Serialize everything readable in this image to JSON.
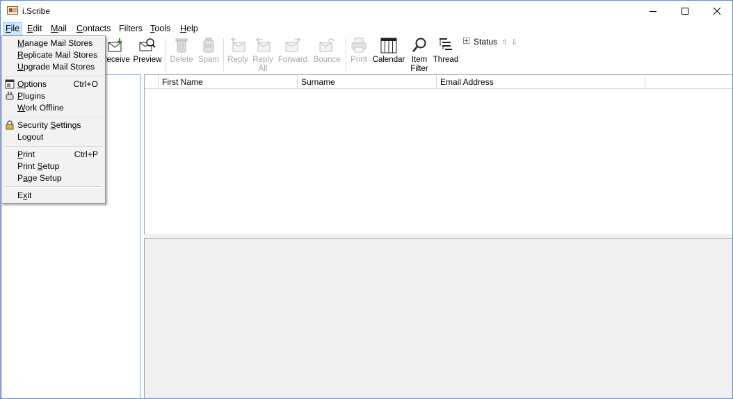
{
  "window": {
    "title": "i.Scribe"
  },
  "menubar": {
    "items": [
      {
        "label": "File",
        "mnemonic": "F",
        "rest": "ile"
      },
      {
        "label": "Edit",
        "mnemonic": "E",
        "rest": "dit"
      },
      {
        "label": "Mail",
        "mnemonic": "M",
        "rest": "ail"
      },
      {
        "label": "Contacts",
        "mnemonic": "C",
        "rest": "ontacts"
      },
      {
        "label": "Filters",
        "mnemonic": "",
        "rest": "Filters"
      },
      {
        "label": "Tools",
        "mnemonic": "T",
        "rest": "ools"
      },
      {
        "label": "Help",
        "mnemonic": "H",
        "rest": "elp"
      }
    ]
  },
  "toolbar": {
    "receive": "Receive",
    "preview": "Preview",
    "delete": "Delete",
    "spam": "Spam",
    "reply": "Reply",
    "reply_all_1": "Reply",
    "reply_all_2": "All",
    "forward": "Forward",
    "bounce": "Bounce",
    "print": "Print",
    "calendar": "Calendar",
    "item_filter_1": "Item",
    "item_filter_2": "Filter",
    "thread": "Thread",
    "status": "Status"
  },
  "columns": [
    "First Name",
    "Surname",
    "Email Address"
  ],
  "file_menu": {
    "manage_pre": "",
    "manage_mn": "M",
    "manage_post": "anage Mail Stores",
    "replicate_pre": "",
    "replicate_mn": "R",
    "replicate_post": "eplicate Mail Stores",
    "upgrade_pre": "",
    "upgrade_mn": "U",
    "upgrade_post": "pgrade Mail Stores",
    "options_pre": "",
    "options_mn": "O",
    "options_post": "ptions",
    "options_shortcut": "Ctrl+O",
    "plugins_pre": "",
    "plugins_mn": "P",
    "plugins_post": "lugins",
    "offline_pre": "",
    "offline_mn": "W",
    "offline_post": "ork Offline",
    "security_pre": "Security ",
    "security_mn": "S",
    "security_post": "ettings",
    "logout": "Logout",
    "print_pre": "",
    "print_mn": "P",
    "print_post": "rint",
    "print_shortcut": "Ctrl+P",
    "print_setup_pre": "Print ",
    "print_setup_mn": "S",
    "print_setup_post": "etup",
    "page_setup_pre": "P",
    "page_setup_mn": "a",
    "page_setup_post": "ge Setup",
    "exit_pre": "E",
    "exit_mn": "x",
    "exit_post": "it"
  },
  "colors": {
    "accent": "#cce8ff",
    "border": "#99d1ff",
    "disabled": "#a8a8a8"
  }
}
